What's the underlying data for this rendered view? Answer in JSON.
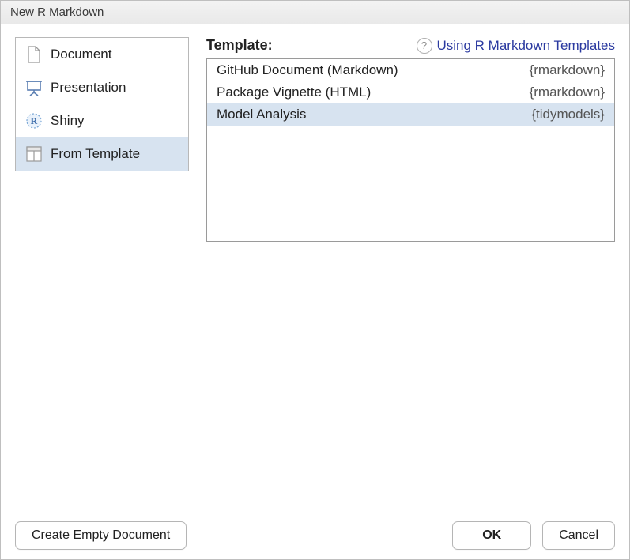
{
  "window": {
    "title": "New R Markdown"
  },
  "sidebar": {
    "items": [
      {
        "id": "document",
        "label": "Document",
        "selected": false
      },
      {
        "id": "presentation",
        "label": "Presentation",
        "selected": false
      },
      {
        "id": "shiny",
        "label": "Shiny",
        "selected": false
      },
      {
        "id": "from-template",
        "label": "From Template",
        "selected": true
      }
    ]
  },
  "template": {
    "label": "Template:",
    "help_link_text": "Using R Markdown Templates",
    "help_badge": "?",
    "items": [
      {
        "name": "GitHub Document (Markdown)",
        "package": "{rmarkdown}",
        "selected": false
      },
      {
        "name": "Package Vignette (HTML)",
        "package": "{rmarkdown}",
        "selected": false
      },
      {
        "name": "Model Analysis",
        "package": "{tidymodels}",
        "selected": true
      }
    ]
  },
  "buttons": {
    "create_empty": "Create Empty Document",
    "ok": "OK",
    "cancel": "Cancel"
  }
}
